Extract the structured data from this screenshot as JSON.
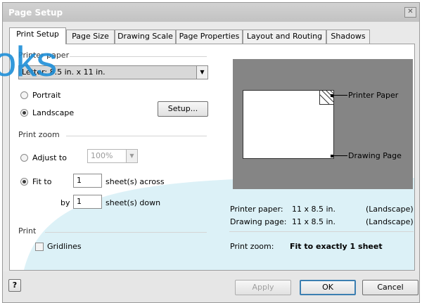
{
  "window": {
    "title": "Page Setup",
    "close_glyph": "✕"
  },
  "tabs": [
    {
      "label": "Print Setup",
      "selected": true
    },
    {
      "label": "Page Size"
    },
    {
      "label": "Drawing Scale"
    },
    {
      "label": "Page Properties"
    },
    {
      "label": "Layout and Routing"
    },
    {
      "label": "Shadows"
    }
  ],
  "printer_paper": {
    "group_label": "Printer paper",
    "selected": "Letter: 8.5 in. x 11 in.",
    "portrait_label": "Portrait",
    "landscape_label": "Landscape",
    "orientation": "Landscape",
    "setup_button": "Setup..."
  },
  "print_zoom": {
    "group_label": "Print zoom",
    "adjust_label": "Adjust to",
    "adjust_value": "100%",
    "fit_label": "Fit to",
    "across_value": "1",
    "across_label": "sheet(s) across",
    "by_label": "by",
    "down_value": "1",
    "down_label": "sheet(s) down"
  },
  "print": {
    "group_label": "Print",
    "gridlines_label": "Gridlines",
    "gridlines_checked": false
  },
  "preview": {
    "printer_paper_label": "Printer Paper",
    "drawing_page_label": "Drawing Page"
  },
  "summary": {
    "printer_paper_label": "Printer paper:",
    "printer_paper_value": "11 x 8.5 in.",
    "printer_paper_orient": "(Landscape)",
    "drawing_page_label": "Drawing page:",
    "drawing_page_value": "11 x 8.5 in.",
    "drawing_page_orient": "(Landscape)",
    "print_zoom_label": "Print zoom:",
    "print_zoom_value": "Fit to exactly 1 sheet"
  },
  "buttons": {
    "help_glyph": "?",
    "apply": "Apply",
    "ok": "OK",
    "cancel": "Cancel"
  },
  "colors": {
    "accent_light_blue": "#dcf1f7",
    "watermark_blue": "#1e8fd8",
    "preview_bg": "#858585"
  }
}
